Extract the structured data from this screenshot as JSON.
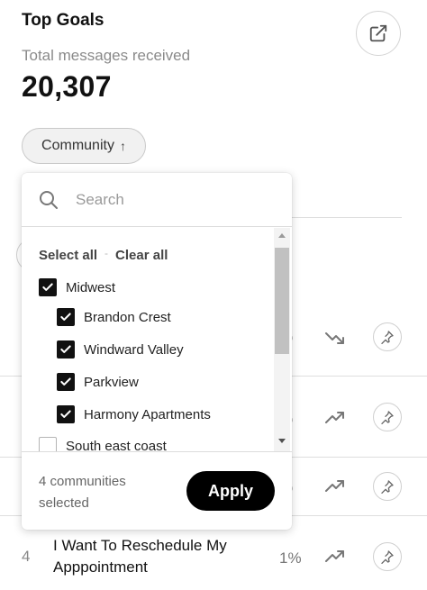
{
  "header": {
    "title": "Top Goals",
    "subtitle": "Total messages received",
    "total": "20,307"
  },
  "filter": {
    "label": "Community",
    "sort_arrow": "↑"
  },
  "dropdown": {
    "search_placeholder": "Search",
    "select_all": "Select all",
    "separator": "-",
    "clear_all": "Clear all",
    "options": [
      {
        "label": "Midwest",
        "checked": true,
        "level": 0
      },
      {
        "label": "Brandon Crest",
        "checked": true,
        "level": 1
      },
      {
        "label": "Windward Valley",
        "checked": true,
        "level": 1
      },
      {
        "label": "Parkview",
        "checked": true,
        "level": 1
      },
      {
        "label": "Harmony Apartments",
        "checked": true,
        "level": 1
      },
      {
        "label": "South east coast",
        "checked": false,
        "level": 0
      }
    ],
    "selected_text": "4 communities selected",
    "apply_label": "Apply"
  },
  "rows": [
    {
      "pct": "%",
      "trend": "trending-down"
    },
    {
      "pct": "%",
      "trend": "trending-up"
    },
    {
      "pct": "%",
      "trend": "trending-up"
    },
    {
      "rank": "4",
      "label": "I Want To Reschedule My Apppointment",
      "pct": "1%",
      "trend": "trending-up"
    }
  ]
}
